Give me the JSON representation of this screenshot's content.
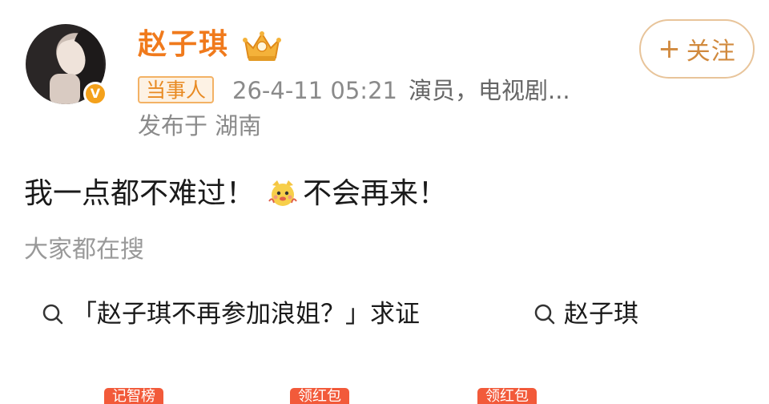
{
  "post": {
    "username": "赵子琪",
    "follow_label": "关注",
    "tag": "当事人",
    "timestamp": "26-4-11 05:21",
    "description": "演员，电视剧...",
    "location": "发布于 湖南",
    "text_before": "我一点都不难过！",
    "text_after": "不会再来！"
  },
  "search": {
    "heading": "大家都在搜",
    "items": [
      "「赵子琪不再参加浪姐？」求证",
      "赵子琪"
    ]
  },
  "bottom_tags": [
    "记智榜",
    "领红包",
    "领红包"
  ],
  "colors": {
    "username": "#f07a1c",
    "tag_border": "#f3b265",
    "follow_border": "#e8c49a",
    "verified": "#f4a11b"
  },
  "icons": [
    "crown-icon",
    "verified-icon",
    "plus-icon",
    "emoji-icon",
    "search-icon"
  ]
}
